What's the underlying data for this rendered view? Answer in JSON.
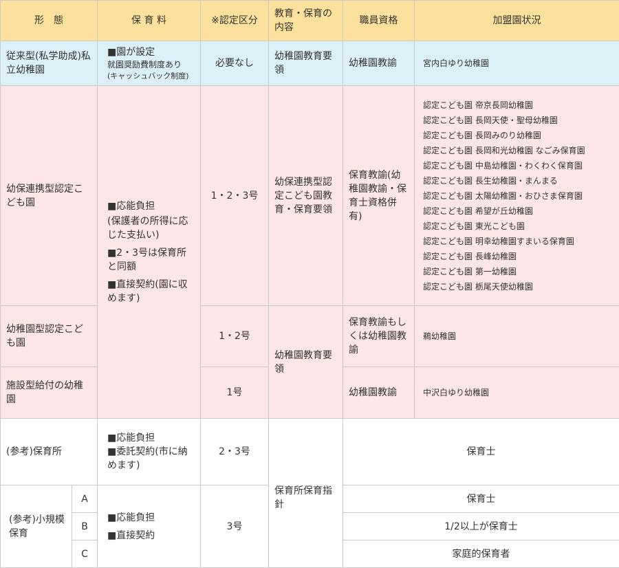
{
  "headers": [
    "形　態",
    "保 育 料",
    "※認定区分",
    "教育・保育の内容",
    "職員資格",
    "加盟園状況"
  ],
  "row_private": {
    "form": "従来型(私学助成)私立幼稚園",
    "fee_main": "■園が設定",
    "fee_sub": "就園奨励費制度あり",
    "fee_note": "(キャッシュバック制度)",
    "certification": "必要なし",
    "content": "幼稚園教育要領",
    "staff": "幼稚園教諭",
    "members": "宮内白ゆり幼稚園"
  },
  "row_collab": {
    "form": "幼保連携型認定こども園",
    "certification": "1・2・3号",
    "content": "幼保連携型認定こども園教育・保育要領",
    "staff": "保育教諭(幼稚園教諭・保育士資格併有)",
    "members": [
      "認定こども園 帝京長岡幼稚園",
      "認定こども園 長岡天使・聖母幼稚園",
      "認定こども園 長岡みのり幼稚園",
      "認定こども園 長岡和光幼稚園 なごみ保育園",
      "認定こども園 中島幼稚園・わくわく保育園",
      "認定こども園 長生幼稚園・まんまる",
      "認定こども園 太陽幼稚園・おひさま保育園",
      "認定こども園 希望が丘幼稚園",
      "認定こども園 東光こども園",
      "認定こども園 明幸幼稚園すまいる保育園",
      "認定こども園 長峰幼稚園",
      "認定こども園 第一幼稚園",
      "認定こども園 栃尾天使幼稚園"
    ]
  },
  "fee_shared": {
    "line1": "■応能負担",
    "line2": "(保護者の所得に応じた支払い)",
    "line3": "■2・3号は保育所と同額",
    "line4": "■直接契約(園に収めます)"
  },
  "row_kinder_type": {
    "form": "幼稚園型認定こども園",
    "certification": "1・2号",
    "content": "幼稚園教育要領",
    "staff": "保育教諭もしくは幼稚園教諭",
    "members": "鵜幼稚園"
  },
  "row_facility": {
    "form": "施設型給付の幼稚園",
    "certification": "1号",
    "staff": "幼稚園教諭",
    "members": "中沢白ゆり幼稚園"
  },
  "row_nursery": {
    "form": "(参考)保育所",
    "fee1": "■応能負担",
    "fee2": "■委託契約(市に納めます)",
    "certification": "2・3号",
    "content": "保育所保育指針",
    "staff_members": "保育士"
  },
  "row_small": {
    "form": "(参考)小規模保育",
    "fee1": "■応能負担",
    "fee2": "■直接契約",
    "certification": "3号",
    "sub": [
      {
        "label": "A",
        "staff": "保育士"
      },
      {
        "label": "B",
        "staff": "1/2以上が保育士"
      },
      {
        "label": "C",
        "staff": "家庭的保育者"
      }
    ]
  }
}
